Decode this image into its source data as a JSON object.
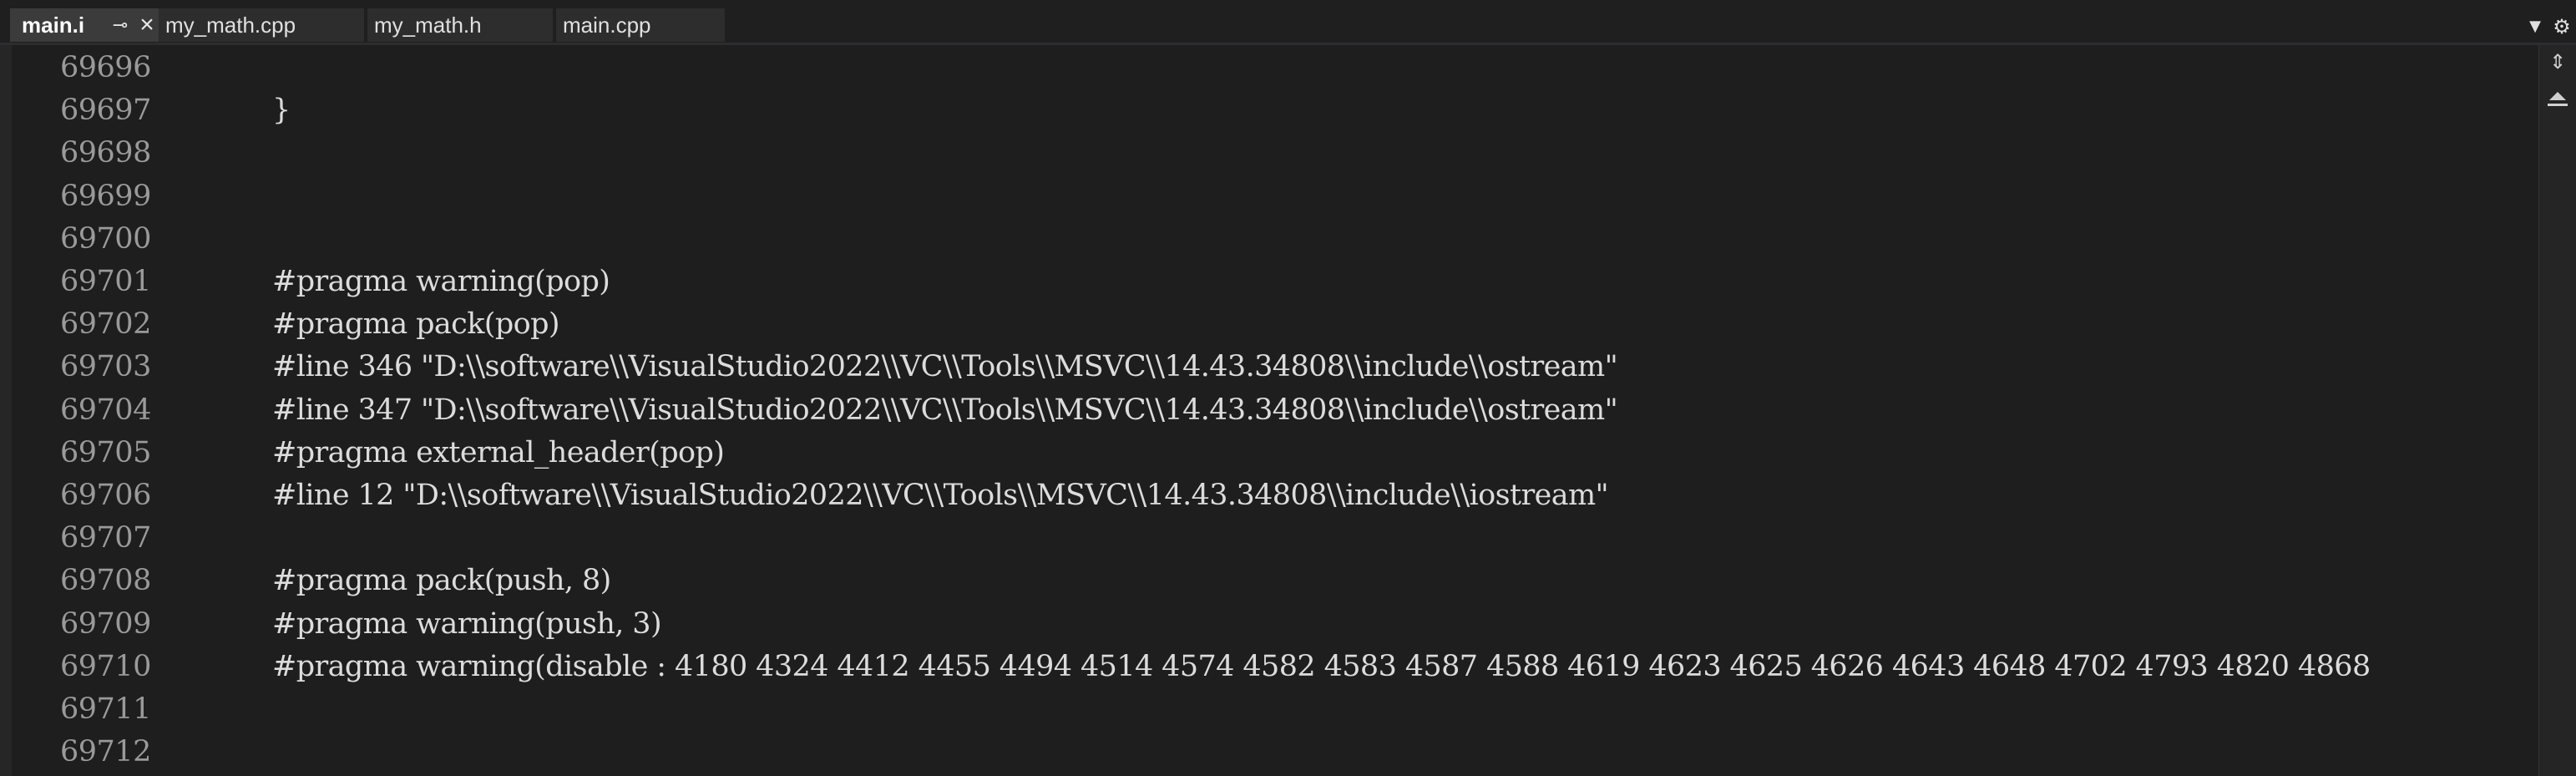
{
  "tabs": [
    {
      "label": "main.i",
      "active": true,
      "pinned": true
    },
    {
      "label": "my_math.cpp",
      "active": false
    },
    {
      "label": "my_math.h",
      "active": false
    },
    {
      "label": "main.cpp",
      "active": false
    }
  ],
  "icons": {
    "pin": "pin-icon",
    "close": "close-icon",
    "dropdown": "chevron-down-icon",
    "settings": "gear-icon",
    "split": "split-editor-icon",
    "scroll_up": "scroll-up-icon"
  },
  "colors": {
    "background": "#1e1e1e",
    "line_number": "#9a9a9a",
    "code_text": "#dcdcdc",
    "active_tab": "#3b3b3b",
    "inactive_tab": "#2d2d2d"
  },
  "editor": {
    "lines": [
      {
        "number": "69696",
        "text": ""
      },
      {
        "number": "69697",
        "text": "}"
      },
      {
        "number": "69698",
        "text": ""
      },
      {
        "number": "69699",
        "text": ""
      },
      {
        "number": "69700",
        "text": ""
      },
      {
        "number": "69701",
        "text": "#pragma warning(pop)"
      },
      {
        "number": "69702",
        "text": "#pragma pack(pop)"
      },
      {
        "number": "69703",
        "text": "#line 346 \"D:\\\\software\\\\VisualStudio2022\\\\VC\\\\Tools\\\\MSVC\\\\14.43.34808\\\\include\\\\ostream\""
      },
      {
        "number": "69704",
        "text": "#line 347 \"D:\\\\software\\\\VisualStudio2022\\\\VC\\\\Tools\\\\MSVC\\\\14.43.34808\\\\include\\\\ostream\""
      },
      {
        "number": "69705",
        "text": "#pragma external_header(pop)"
      },
      {
        "number": "69706",
        "text": "#line 12 \"D:\\\\software\\\\VisualStudio2022\\\\VC\\\\Tools\\\\MSVC\\\\14.43.34808\\\\include\\\\iostream\""
      },
      {
        "number": "69707",
        "text": ""
      },
      {
        "number": "69708",
        "text": "#pragma pack(push, 8)"
      },
      {
        "number": "69709",
        "text": "#pragma warning(push, 3)"
      },
      {
        "number": "69710",
        "text": "#pragma warning(disable : 4180 4324 4412 4455 4494 4514 4574 4582 4583 4587 4588 4619 4623 4625 4626 4643 4648 4702 4793 4820 4868"
      },
      {
        "number": "69711",
        "text": ""
      },
      {
        "number": "69712",
        "text": ""
      }
    ]
  }
}
